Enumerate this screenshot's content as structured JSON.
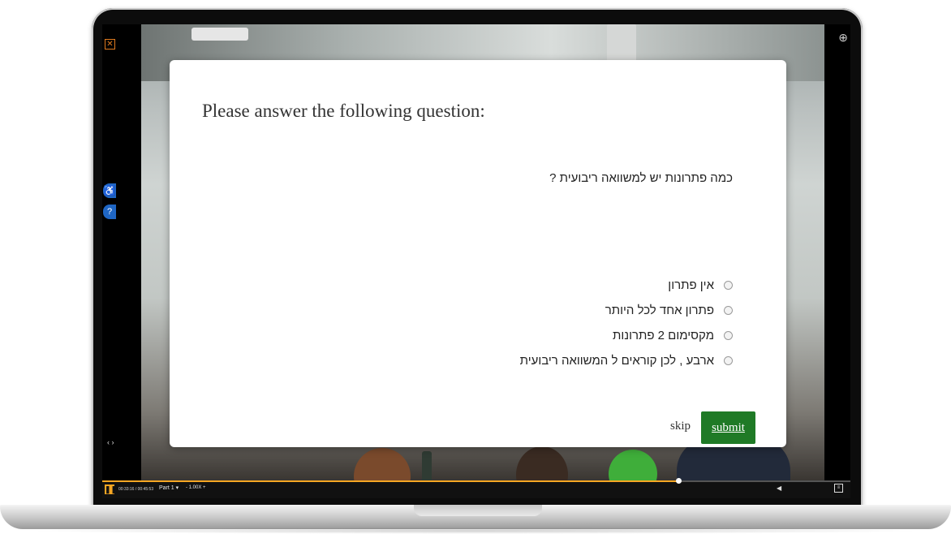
{
  "quiz": {
    "title": "Please answer the following question:",
    "question": "כמה פתרונות יש למשוואה ריבועית ?",
    "options": [
      {
        "label": "אין פתרון"
      },
      {
        "label": "פתרון אחד לכל היותר"
      },
      {
        "label": "מקסימום 2 פתרונות"
      },
      {
        "label": "ארבע , לכן קוראים ל המשוואה ריבועית"
      }
    ],
    "skip_label": "skip",
    "submit_label": "submit"
  },
  "player": {
    "time": "00:33:16 / 00:45:53",
    "part": "Part 1 ▾",
    "speed": "- 1.00X +",
    "progress": 0.77,
    "accent": "#f5a623"
  },
  "icons": {
    "close": "close-icon",
    "accessibility": "accessibility-icon",
    "help": "help-icon",
    "zoom": "zoom-in-icon",
    "expand": "expand-icon",
    "play": "play-pause-icon",
    "volume": "volume-icon",
    "captions": "captions-icon"
  },
  "colors": {
    "submit_bg": "#1f7a26",
    "side_icon_bg": "#1f66c4"
  }
}
